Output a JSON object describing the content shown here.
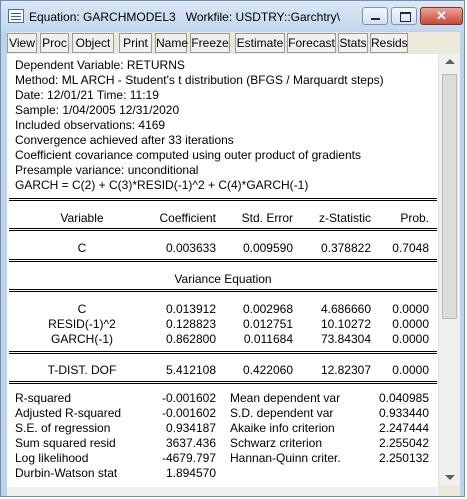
{
  "window": {
    "title": "Equation: GARCHMODEL3",
    "workfile": "Workfile: USDTRY::Garchtry\\",
    "close_glyph": "✕"
  },
  "toolbar": [
    "View",
    "Proc",
    "Object",
    "Print",
    "Name",
    "Freeze",
    "Estimate",
    "Forecast",
    "Stats",
    "Resids"
  ],
  "header_lines": [
    "Dependent Variable: RETURNS",
    "Method: ML ARCH - Student's t distribution (BFGS / Marquardt steps)",
    "Date: 12/01/21   Time: 11:19",
    "Sample: 1/04/2005 12/31/2020",
    "Included observations: 4169",
    "Convergence achieved after 33 iterations",
    "Coefficient covariance computed using outer product of gradients",
    "Presample variance: unconditional",
    "GARCH = C(2) + C(3)*RESID(-1)^2 + C(4)*GARCH(-1)"
  ],
  "columns": [
    "Variable",
    "Coefficient",
    "Std. Error",
    "z-Statistic",
    "Prob."
  ],
  "mean_rows": [
    {
      "variable": "C",
      "coef": "0.003633",
      "se": "0.009590",
      "z": "0.378822",
      "prob": "0.7048"
    }
  ],
  "variance_title": "Variance Equation",
  "variance_rows": [
    {
      "variable": "C",
      "coef": "0.013912",
      "se": "0.002968",
      "z": "4.686660",
      "prob": "0.0000"
    },
    {
      "variable": "RESID(-1)^2",
      "coef": "0.128823",
      "se": "0.012751",
      "z": "10.10272",
      "prob": "0.0000"
    },
    {
      "variable": "GARCH(-1)",
      "coef": "0.862800",
      "se": "0.011684",
      "z": "73.84304",
      "prob": "0.0000"
    }
  ],
  "dist_rows": [
    {
      "variable": "T-DIST. DOF",
      "coef": "5.412108",
      "se": "0.422060",
      "z": "12.82307",
      "prob": "0.0000"
    }
  ],
  "stats": [
    {
      "l_label": "R-squared",
      "l_value": "-0.001602",
      "r_label": "Mean dependent var",
      "r_value": "0.040985"
    },
    {
      "l_label": "Adjusted R-squared",
      "l_value": "-0.001602",
      "r_label": "S.D. dependent var",
      "r_value": "0.933440"
    },
    {
      "l_label": "S.E. of regression",
      "l_value": "0.934187",
      "r_label": "Akaike info criterion",
      "r_value": "2.247444"
    },
    {
      "l_label": "Sum squared resid",
      "l_value": "3637.436",
      "r_label": "Schwarz criterion",
      "r_value": "2.255042"
    },
    {
      "l_label": "Log likelihood",
      "l_value": "-4679.797",
      "r_label": "Hannan-Quinn criter.",
      "r_value": "2.250132"
    },
    {
      "l_label": "Durbin-Watson stat",
      "l_value": "1.894570",
      "r_label": "",
      "r_value": ""
    }
  ]
}
